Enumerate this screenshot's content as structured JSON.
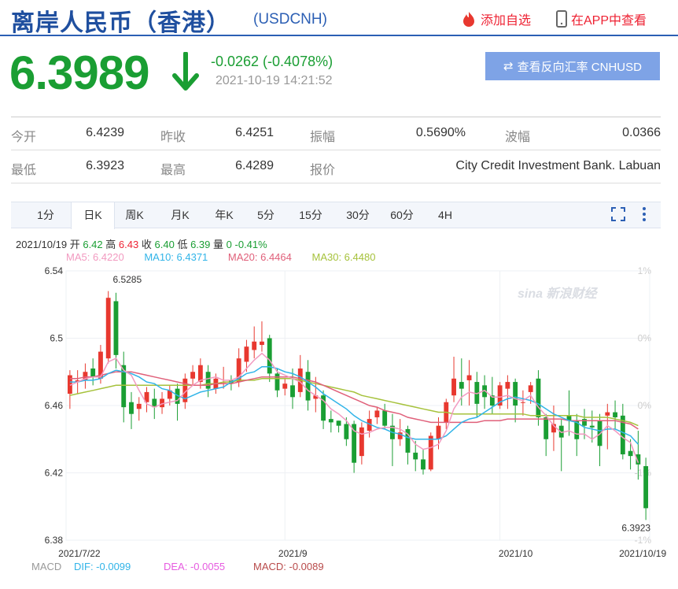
{
  "header": {
    "title": "离岸人民币（香港）",
    "code": "(USDCNH)",
    "fav_label": "添加自选",
    "app_label": "在APP中查看"
  },
  "quote": {
    "price": "6.3989",
    "change": "-0.0262 (-0.4078%)",
    "time": "2021-10-19 14:21:52",
    "reverse_button": "查看反向汇率 CNHUSD"
  },
  "stats": {
    "open_label": "今开",
    "open": "6.4239",
    "prev_label": "昨收",
    "prev": "6.4251",
    "amp_label": "振幅",
    "amp": "0.5690%",
    "wave_label": "波幅",
    "wave": "0.0366",
    "low_label": "最低",
    "low": "6.3923",
    "high_label": "最高",
    "high": "6.4289",
    "quote_label": "报价",
    "quote_src": "City Credit Investment Bank. Labuan"
  },
  "tabs": [
    "1分",
    "日K",
    "周K",
    "月K",
    "年K",
    "5分",
    "15分",
    "30分",
    "60分",
    "4H"
  ],
  "active_tab": 1,
  "candle_info": {
    "date": "2021/10/19",
    "open_l": "开",
    "open": "6.42",
    "high_l": "高",
    "high": "6.43",
    "close_l": "收",
    "close": "6.40",
    "low_l": "低",
    "low": "6.39",
    "vol_l": "量",
    "vol": "0",
    "pct": "-0.41%"
  },
  "ma": {
    "ma5": "MA5: 6.4220",
    "ma10": "MA10: 6.4371",
    "ma20": "MA20: 6.4464",
    "ma30": "MA30: 6.4480"
  },
  "macd": {
    "label": "MACD",
    "dif": "DIF: -0.0099",
    "dea": "DEA: -0.0055",
    "macd": "MACD: -0.0089"
  },
  "colors": {
    "up": "#e8382f",
    "down": "#1a9e33",
    "ma5": "#f29ac0",
    "ma10": "#31b4e8",
    "ma20": "#e0607a",
    "ma30": "#a6c23c",
    "brand": "#2c5fb4"
  },
  "chart_data": {
    "type": "candlestick",
    "y_ticks": [
      "6.54",
      "6.5",
      "6.46",
      "6.42",
      "6.38"
    ],
    "y_pct_ticks": [
      "1%",
      "0%",
      "0%",
      "-1%",
      "-1%"
    ],
    "x_ticks": [
      "2021/7/22",
      "2021/9",
      "2021/10",
      "2021/10/19"
    ],
    "annotations": {
      "max": "6.5285",
      "min": "6.3923"
    },
    "watermark": "sina 新浪财经",
    "ylim": [
      6.38,
      6.54
    ],
    "candles": [
      [
        6.467,
        6.478,
        6.458,
        6.481
      ],
      [
        6.474,
        6.475,
        6.467,
        6.481
      ],
      [
        6.475,
        6.48,
        6.47,
        6.485
      ],
      [
        6.482,
        6.477,
        6.472,
        6.488
      ],
      [
        6.476,
        6.492,
        6.473,
        6.496
      ],
      [
        6.488,
        6.524,
        6.485,
        6.528
      ],
      [
        6.522,
        6.49,
        6.482,
        6.527
      ],
      [
        6.484,
        6.459,
        6.45,
        6.492
      ],
      [
        6.462,
        6.455,
        6.446,
        6.468
      ],
      [
        6.458,
        6.461,
        6.451,
        6.465
      ],
      [
        6.462,
        6.468,
        6.456,
        6.471
      ],
      [
        6.464,
        6.459,
        6.452,
        6.47
      ],
      [
        6.459,
        6.464,
        6.455,
        6.468
      ],
      [
        6.464,
        6.469,
        6.46,
        6.472
      ],
      [
        6.47,
        6.461,
        6.451,
        6.473
      ],
      [
        6.462,
        6.476,
        6.458,
        6.479
      ],
      [
        6.476,
        6.48,
        6.472,
        6.484
      ],
      [
        6.474,
        6.484,
        6.47,
        6.488
      ],
      [
        6.48,
        6.47,
        6.465,
        6.484
      ],
      [
        6.47,
        6.476,
        6.467,
        6.479
      ],
      [
        6.474,
        6.474,
        6.47,
        6.483
      ],
      [
        6.475,
        6.473,
        6.469,
        6.478
      ],
      [
        6.474,
        6.488,
        6.471,
        6.494
      ],
      [
        6.486,
        6.495,
        6.48,
        6.499
      ],
      [
        6.493,
        6.498,
        6.488,
        6.507
      ],
      [
        6.496,
        6.498,
        6.492,
        6.51
      ],
      [
        6.5,
        6.479,
        6.474,
        6.502
      ],
      [
        6.479,
        6.469,
        6.465,
        6.482
      ],
      [
        6.47,
        6.473,
        6.466,
        6.476
      ],
      [
        6.472,
        6.465,
        6.458,
        6.482
      ],
      [
        6.468,
        6.482,
        6.465,
        6.49
      ],
      [
        6.48,
        6.463,
        6.457,
        6.487
      ],
      [
        6.464,
        6.466,
        6.456,
        6.477
      ],
      [
        6.466,
        6.451,
        6.446,
        6.469
      ],
      [
        6.452,
        6.45,
        6.444,
        6.457
      ],
      [
        6.451,
        6.448,
        6.444,
        6.451
      ],
      [
        6.449,
        6.44,
        6.436,
        6.453
      ],
      [
        6.449,
        6.426,
        6.42,
        6.451
      ],
      [
        6.43,
        6.447,
        6.425,
        6.45
      ],
      [
        6.445,
        6.452,
        6.441,
        6.457
      ],
      [
        6.453,
        6.457,
        6.449,
        6.459
      ],
      [
        6.457,
        6.448,
        6.446,
        6.461
      ],
      [
        6.448,
        6.44,
        6.424,
        6.455
      ],
      [
        6.44,
        6.444,
        6.436,
        6.452
      ],
      [
        6.446,
        6.432,
        6.425,
        6.448
      ],
      [
        6.432,
        6.428,
        6.421,
        6.439
      ],
      [
        6.428,
        6.422,
        6.419,
        6.434
      ],
      [
        6.422,
        6.442,
        6.421,
        6.444
      ],
      [
        6.44,
        6.448,
        6.434,
        6.453
      ],
      [
        6.45,
        6.462,
        6.446,
        6.464
      ],
      [
        6.466,
        6.476,
        6.462,
        6.489
      ],
      [
        6.474,
        6.47,
        6.46,
        6.488
      ],
      [
        6.475,
        6.478,
        6.46,
        6.487
      ],
      [
        6.474,
        6.461,
        6.453,
        6.48
      ],
      [
        6.472,
        6.465,
        6.458,
        6.478
      ],
      [
        6.466,
        6.46,
        6.455,
        6.477
      ],
      [
        6.46,
        6.472,
        6.458,
        6.474
      ],
      [
        6.47,
        6.474,
        6.458,
        6.478
      ],
      [
        6.474,
        6.46,
        6.45,
        6.476
      ],
      [
        6.462,
        6.462,
        6.454,
        6.469
      ],
      [
        6.468,
        6.472,
        6.461,
        6.474
      ],
      [
        6.476,
        6.453,
        6.448,
        6.481
      ],
      [
        6.453,
        6.44,
        6.43,
        6.455
      ],
      [
        6.444,
        6.449,
        6.433,
        6.46
      ],
      [
        6.448,
        6.441,
        6.421,
        6.452
      ],
      [
        6.454,
        6.451,
        6.442,
        6.469
      ],
      [
        6.451,
        6.44,
        6.43,
        6.455
      ],
      [
        6.452,
        6.448,
        6.44,
        6.458
      ],
      [
        6.448,
        6.447,
        6.438,
        6.457
      ],
      [
        6.451,
        6.436,
        6.424,
        6.455
      ],
      [
        6.454,
        6.456,
        6.434,
        6.461
      ],
      [
        6.456,
        6.453,
        6.446,
        6.463
      ],
      [
        6.454,
        6.431,
        6.428,
        6.461
      ],
      [
        6.433,
        6.43,
        6.422,
        6.44
      ],
      [
        6.431,
        6.425,
        6.416,
        6.445
      ],
      [
        6.424,
        6.399,
        6.392,
        6.429
      ]
    ],
    "ma5": [
      6.472,
      6.474,
      6.476,
      6.477,
      6.477,
      6.486,
      6.488,
      6.481,
      6.478,
      6.469,
      6.461,
      6.459,
      6.461,
      6.462,
      6.463,
      6.468,
      6.472,
      6.475,
      6.476,
      6.477,
      6.475,
      6.475,
      6.477,
      6.482,
      6.487,
      6.491,
      6.487,
      6.48,
      6.478,
      6.476,
      6.474,
      6.469,
      6.466,
      6.463,
      6.458,
      6.455,
      6.451,
      6.445,
      6.443,
      6.444,
      6.446,
      6.447,
      6.447,
      6.446,
      6.443,
      6.437,
      6.434,
      6.435,
      6.437,
      6.445,
      6.458,
      6.465,
      6.468,
      6.467,
      6.469,
      6.465,
      6.465,
      6.466,
      6.464,
      6.463,
      6.466,
      6.459,
      6.454,
      6.448,
      6.444,
      6.445,
      6.443,
      6.443,
      6.44,
      6.443,
      6.448,
      6.445,
      6.441,
      6.438,
      6.426
    ],
    "ma10": [
      6.474,
      6.474,
      6.475,
      6.475,
      6.476,
      6.479,
      6.481,
      6.48,
      6.479,
      6.477,
      6.474,
      6.473,
      6.47,
      6.469,
      6.466,
      6.464,
      6.466,
      6.468,
      6.469,
      6.47,
      6.471,
      6.474,
      6.476,
      6.479,
      6.48,
      6.483,
      6.483,
      6.482,
      6.48,
      6.479,
      6.477,
      6.474,
      6.471,
      6.467,
      6.464,
      6.461,
      6.458,
      6.454,
      6.451,
      6.449,
      6.447,
      6.446,
      6.444,
      6.443,
      6.441,
      6.44,
      6.44,
      6.44,
      6.44,
      6.442,
      6.446,
      6.45,
      6.452,
      6.453,
      6.456,
      6.459,
      6.462,
      6.464,
      6.465,
      6.464,
      6.463,
      6.461,
      6.458,
      6.455,
      6.453,
      6.451,
      6.45,
      6.447,
      6.446,
      6.445,
      6.446,
      6.446,
      6.444,
      6.442,
      6.437
    ],
    "ma20": [
      6.476,
      6.476,
      6.477,
      6.477,
      6.478,
      6.479,
      6.48,
      6.48,
      6.48,
      6.479,
      6.478,
      6.477,
      6.476,
      6.475,
      6.474,
      6.473,
      6.472,
      6.472,
      6.472,
      6.473,
      6.473,
      6.473,
      6.474,
      6.475,
      6.476,
      6.477,
      6.477,
      6.477,
      6.477,
      6.477,
      6.476,
      6.475,
      6.474,
      6.472,
      6.47,
      6.468,
      6.466,
      6.464,
      6.462,
      6.46,
      6.459,
      6.457,
      6.456,
      6.455,
      6.453,
      6.452,
      6.451,
      6.45,
      6.45,
      6.45,
      6.45,
      6.45,
      6.45,
      6.45,
      6.451,
      6.451,
      6.451,
      6.452,
      6.452,
      6.452,
      6.452,
      6.452,
      6.452,
      6.452,
      6.452,
      6.451,
      6.451,
      6.451,
      6.451,
      6.451,
      6.451,
      6.451,
      6.45,
      6.449,
      6.446
    ],
    "ma30": [
      6.466,
      6.467,
      6.468,
      6.469,
      6.47,
      6.471,
      6.472,
      6.472,
      6.472,
      6.472,
      6.472,
      6.472,
      6.472,
      6.472,
      6.472,
      6.472,
      6.472,
      6.472,
      6.473,
      6.473,
      6.474,
      6.474,
      6.475,
      6.475,
      6.475,
      6.476,
      6.476,
      6.476,
      6.476,
      6.476,
      6.475,
      6.474,
      6.473,
      6.472,
      6.471,
      6.47,
      6.469,
      6.468,
      6.466,
      6.465,
      6.464,
      6.463,
      6.462,
      6.461,
      6.46,
      6.459,
      6.458,
      6.457,
      6.456,
      6.456,
      6.455,
      6.455,
      6.455,
      6.455,
      6.455,
      6.455,
      6.455,
      6.455,
      6.455,
      6.455,
      6.454,
      6.454,
      6.454,
      6.454,
      6.454,
      6.454,
      6.454,
      6.453,
      6.453,
      6.453,
      6.453,
      6.452,
      6.451,
      6.45,
      6.448
    ]
  }
}
